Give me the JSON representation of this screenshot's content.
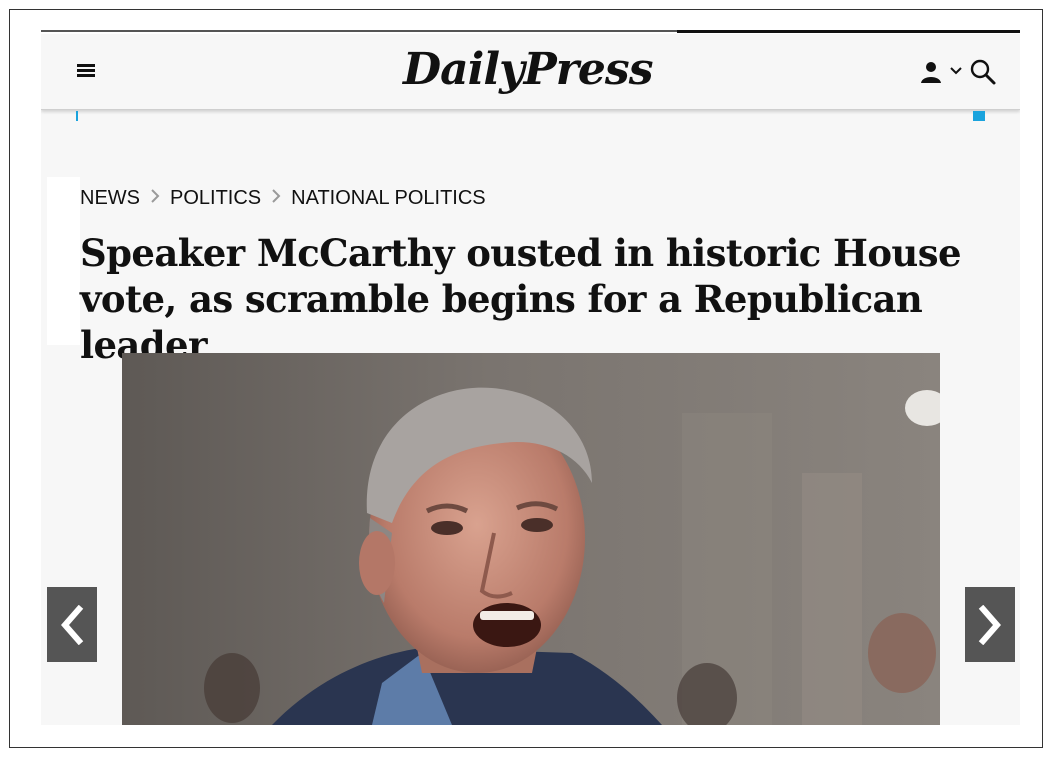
{
  "header": {
    "logo_text": "DailyPress",
    "menu_icon": "hamburger-menu-icon",
    "account_icon": "person-icon",
    "account_chevron_icon": "chevron-down-icon",
    "search_icon": "search-icon"
  },
  "breadcrumb": {
    "items": [
      {
        "label": "NEWS"
      },
      {
        "label": "POLITICS"
      },
      {
        "label": "NATIONAL POLITICS"
      }
    ],
    "separator_icon": "chevron-right-icon"
  },
  "article": {
    "headline": "Speaker McCarthy ousted in historic House vote, as scramble begins for a Republican leader"
  },
  "gallery": {
    "prev_icon": "chevron-left-icon",
    "next_icon": "chevron-right-icon"
  },
  "colors": {
    "accent_blue": "#1aa3dd",
    "nav_button": "#555555",
    "text": "#111111"
  }
}
